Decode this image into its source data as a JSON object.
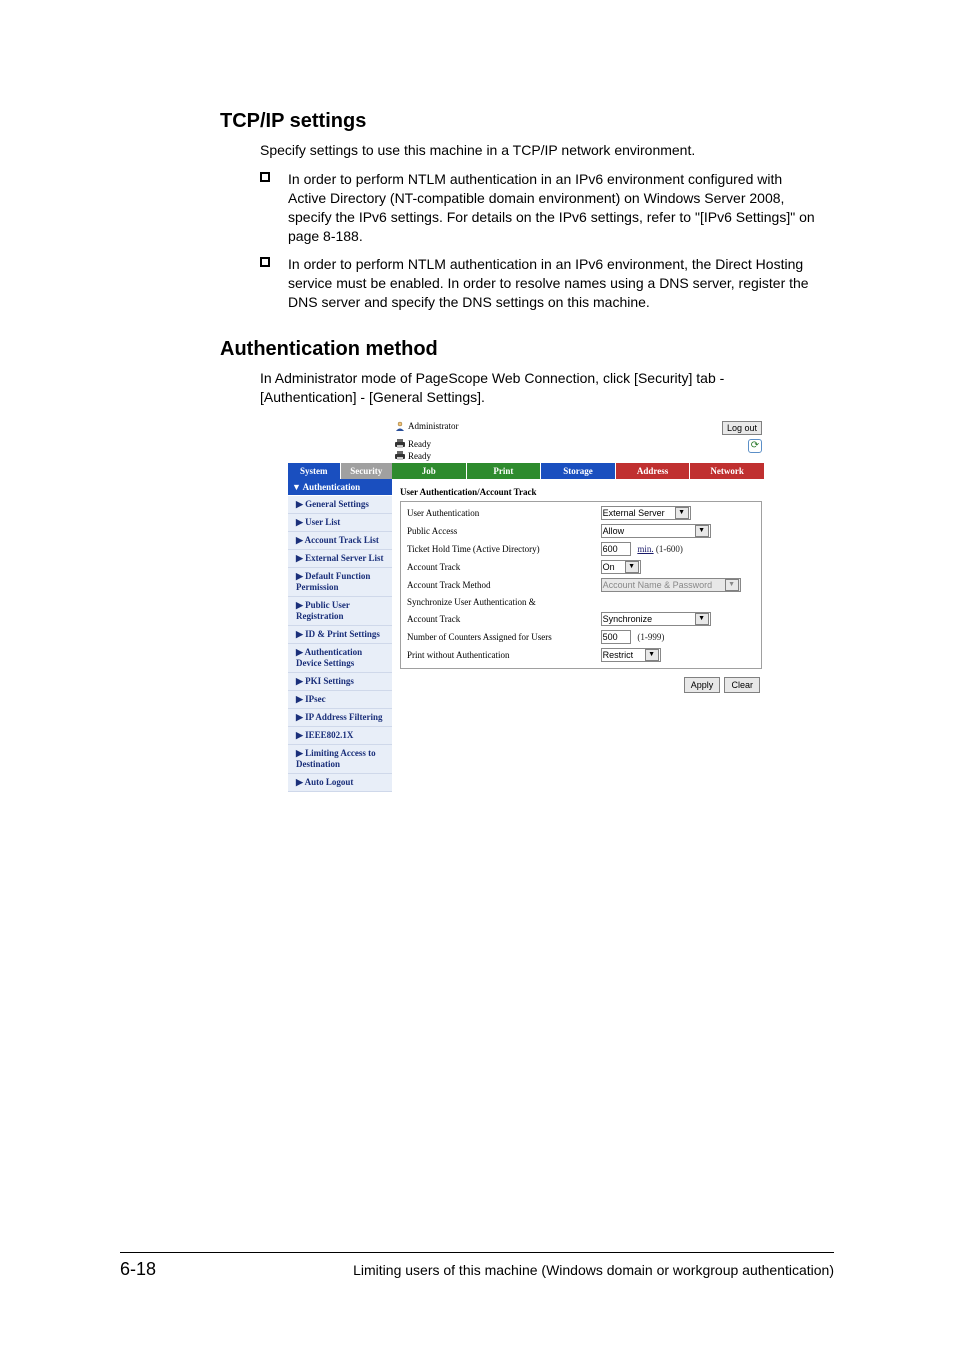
{
  "sections": {
    "tcpip": {
      "heading": "TCP/IP settings",
      "intro": "Specify settings to use this machine in a TCP/IP network environment.",
      "bullets": [
        "In order to perform NTLM authentication in an IPv6 environment configured with Active Directory (NT-compatible domain environment) on Windows Server 2008, specify the IPv6 settings. For details on the IPv6 settings, refer to \"[IPv6 Settings]\" on page 8-188.",
        "In order to perform NTLM authentication in an IPv6 environment, the Direct Hosting service must be enabled. In order to resolve names using a DNS server, register the DNS server and specify the DNS settings on this machine."
      ]
    },
    "authmethod": {
      "heading": "Authentication method",
      "intro": "In Administrator mode of PageScope Web Connection, click [Security] tab - [Authentication] - [General Settings]."
    }
  },
  "screenshot": {
    "top": {
      "admin_label": "Administrator",
      "logout": "Log out",
      "ready": "Ready"
    },
    "tabs_left": [
      "System",
      "Security"
    ],
    "tabs_right": [
      "Job",
      "Print",
      "Storage",
      "Address",
      "Network"
    ],
    "sidebar": {
      "header": "▼ Authentication",
      "items": [
        "▶ General Settings",
        "▶ User List",
        "▶ Account Track List",
        "▶ External Server List",
        "▶ Default Function Permission",
        "▶ Public User Registration",
        "▶ ID & Print Settings",
        "▶ Authentication Device Settings",
        "▶ PKI Settings",
        "▶ IPsec",
        "▶ IP Address Filtering",
        "▶ IEEE802.1X",
        "▶ Limiting Access to Destination",
        "▶ Auto Logout"
      ]
    },
    "panel": {
      "title": "User Authentication/Account Track",
      "rows": {
        "user_auth_label": "User Authentication",
        "user_auth_value": "External Server",
        "public_access_label": "Public Access",
        "public_access_value": "Allow",
        "ticket_label": "Ticket Hold Time (Active Directory)",
        "ticket_value": "600",
        "ticket_hint_unit": "min.",
        "ticket_hint_range": " (1-600)",
        "account_track_label": "Account Track",
        "account_track_value": "On",
        "atm_label": "Account Track Method",
        "atm_value": "Account Name & Password",
        "sync_label1": "Synchronize User Authentication &",
        "sync_label2": "Account Track",
        "sync_value": "Synchronize",
        "counters_label": "Number of Counters Assigned for Users",
        "counters_value": "500",
        "counters_hint": "(1-999)",
        "pwa_label": "Print without Authentication",
        "pwa_value": "Restrict"
      },
      "buttons": {
        "apply": "Apply",
        "clear": "Clear"
      }
    }
  },
  "footer": {
    "page": "6-18",
    "title": "Limiting users of this machine (Windows domain or workgroup authentication)"
  }
}
